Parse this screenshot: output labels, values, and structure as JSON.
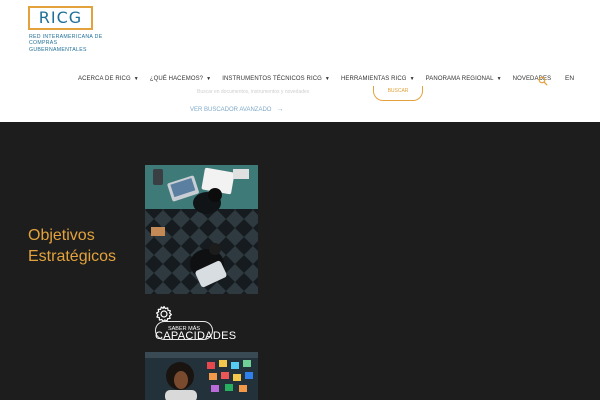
{
  "logo": {
    "name": "RICG",
    "subtitle": "RED INTERAMERICANA DE COMPRAS GUBERNAMENTALES"
  },
  "nav": {
    "items": [
      {
        "label": "ACERCA DE RICG",
        "caret": "▼"
      },
      {
        "label": "¿QUÉ HACEMOS?",
        "caret": "▼"
      },
      {
        "label": "INSTRUMENTOS TÉCNICOS RICG",
        "caret": "▼"
      },
      {
        "label": "HERRAMIENTAS RICG",
        "caret": "▼"
      },
      {
        "label": "PANORAMA REGIONAL",
        "caret": "▼"
      },
      {
        "label": "NOVEDADES",
        "caret": ""
      }
    ],
    "search_icon": "search-icon",
    "language": "EN"
  },
  "search": {
    "placeholder": "Buscar en documentos, instrumentos y novedades",
    "button_label": "BUSCAR",
    "advanced_label": "VER BUSCADOR AVANZADO",
    "advanced_arrow": "→"
  },
  "main": {
    "section_title_line1": "Objetivos",
    "section_title_line2": "Estratégicos",
    "card": {
      "icon": "gear-icon",
      "button_label": "SABER MÁS",
      "title": "CAPACIDADES"
    }
  },
  "colors": {
    "accent": "#e3a23c",
    "brand_blue": "#1f6f99",
    "dark_bg": "#1d1d1d",
    "link_blue": "#7fa9c9"
  }
}
